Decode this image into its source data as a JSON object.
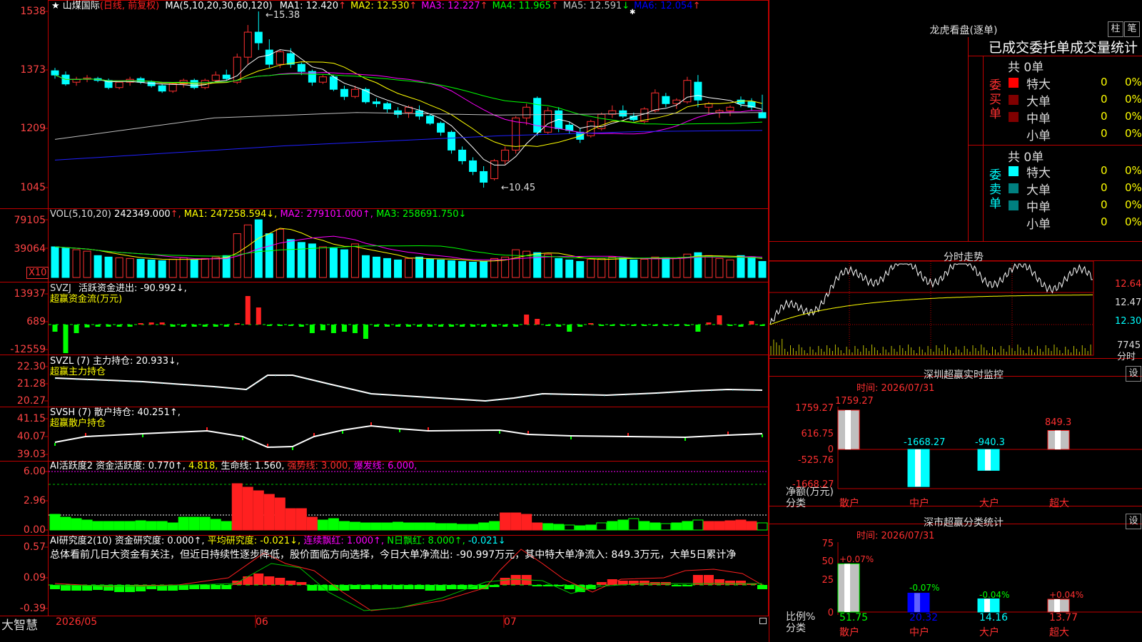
{
  "main": {
    "title": "山煤国际",
    "mode": "(日线, 前复权)",
    "ma_label": "MA(5,10,20,30,60,120)",
    "ma": [
      {
        "label": "MA1:",
        "value": "12.420",
        "arrow": "↑",
        "color": "#ffffff"
      },
      {
        "label": "MA2:",
        "value": "12.530",
        "arrow": "↑",
        "color": "#ffff00"
      },
      {
        "label": "MA3:",
        "value": "12.227",
        "arrow": "↑",
        "color": "#ff00ff"
      },
      {
        "label": "MA4:",
        "value": "11.965",
        "arrow": "↑",
        "color": "#00ff00"
      },
      {
        "label": "MA5:",
        "value": "12.591",
        "arrow": "↓",
        "color": "#c0c0c0"
      },
      {
        "label": "MA6:",
        "value": "12.054",
        "arrow": "↑",
        "color": "#0000ff"
      }
    ],
    "yticks": [
      "1538",
      "1373",
      "1209",
      "1045"
    ],
    "high_label": "15.38",
    "low_label": "10.45"
  },
  "vol": {
    "label": "VOL(5,10,20)",
    "value": "242349.000",
    "ma1": "MA1: 247258.594↓,",
    "ma2": "MA2: 279101.000↑,",
    "ma3": "MA3: 258691.750↓",
    "yticks": [
      "79105",
      "39064"
    ],
    "unit": "X10"
  },
  "svzj": {
    "label": "SVZJ",
    "line": "活跃资金进出: -90.992↓,",
    "sub": "超赢资金流(万元)",
    "yticks": [
      "13937",
      "689",
      "-12559"
    ]
  },
  "svzl": {
    "label": "SVZL (7) 主力持仓: 20.933↓,",
    "sub": "超赢主力持仓",
    "yticks": [
      "22.30",
      "21.28",
      "20.27"
    ]
  },
  "svsh": {
    "label": "SVSH (7) 散户持仓: 40.251↑,",
    "sub": "超赢散户持仓",
    "yticks": [
      "41.15",
      "40.07",
      "39.03"
    ]
  },
  "ai1": {
    "label": "AI活跃度2 资金活跃度: 0.770↑,",
    "v2": "4.818,",
    "v3": "生命线: 1.560,",
    "v4": "强势线: 3.000,",
    "v5": "爆发线: 6.000,",
    "yticks": [
      "6.00",
      "2.96",
      "0.00"
    ]
  },
  "ai2": {
    "label": "AI研究度2(10) 资金研究度: 0.000↑,",
    "v2": "平均研究度: -0.021↓,",
    "v3": "连续飘红: 1.000↑,",
    "v4": "N日飘红: 8.000↑,",
    "v5": "-0.021↓",
    "text": "总体看前几日大资金有关注，但近日持续性逐步降低，股价面临方向选择，今日大单净流出: -90.997万元，其中特大单净流入: 849.3万元，大单5日累计净",
    "yticks": [
      "0.57",
      "0.09",
      "-0.39"
    ]
  },
  "footer": {
    "brand": "大智慧",
    "months": [
      "2026/05",
      "06",
      "07"
    ]
  },
  "lhb": {
    "title": "龙虎看盘(逐单)",
    "btn1": "柱",
    "btn2": "笔",
    "tabs": "已成交委托单成交量统计",
    "buy": {
      "label": "委买单",
      "total": "共 0单",
      "rows": [
        {
          "name": "特大",
          "n": "0",
          "p": "0%",
          "color": "#ff0000"
        },
        {
          "name": "大单",
          "n": "0",
          "p": "0%",
          "color": "#800000"
        },
        {
          "name": "中单",
          "n": "0",
          "p": "0%",
          "color": "#800000"
        },
        {
          "name": "小单",
          "n": "0",
          "p": "0%",
          "color": "#000000"
        }
      ]
    },
    "sell": {
      "label": "委卖单",
      "total": "共 0单",
      "rows": [
        {
          "name": "特大",
          "n": "0",
          "p": "0%",
          "color": "#00ffff"
        },
        {
          "name": "大单",
          "n": "0",
          "p": "0%",
          "color": "#008080"
        },
        {
          "name": "中单",
          "n": "0",
          "p": "0%",
          "color": "#008080"
        },
        {
          "name": "小单",
          "n": "0",
          "p": "0%",
          "color": "#000000"
        }
      ]
    }
  },
  "intraday": {
    "title": "分时走势",
    "yticks": [
      "12.64",
      "12.47",
      "12.30"
    ],
    "vol_tick": "7745",
    "vol_label": "分时"
  },
  "monitor": {
    "title": "深圳超赢实时监控",
    "btn": "设",
    "time": "时间: 2026/07/31",
    "yticks": [
      "1759.27",
      "616.75",
      "0",
      "-525.76",
      "-1668.27"
    ],
    "ylabel": "净额(万元)",
    "xlabel": "分类",
    "categories": [
      "散户",
      "中户",
      "大户",
      "超大"
    ],
    "value_labels": [
      "1759.27",
      "-1668.27",
      "-940.3",
      "849.3"
    ]
  },
  "stats": {
    "title": "深市超赢分类统计",
    "btn": "设",
    "time": "时间: 2026/07/31",
    "yticks": [
      "75",
      "50",
      "25",
      "0"
    ],
    "ylabel": "比例%",
    "xlabel": "分类",
    "categories": [
      "散户",
      "中户",
      "大户",
      "超大"
    ],
    "changes": [
      "+0.07%",
      "-0.07%",
      "-0.04%",
      "+0.04%"
    ],
    "values_label": [
      "51.75",
      "20.32",
      "14.16",
      "13.77"
    ]
  },
  "chart_data": [
    {
      "type": "candlestick",
      "title": "山煤国际 (日线, 前复权)",
      "ylim": [
        10.45,
        15.38
      ],
      "y_ticks": [
        15.38,
        13.73,
        12.09,
        10.45
      ],
      "ohlc": [
        [
          13.72,
          13.8,
          13.5,
          13.6
        ],
        [
          13.6,
          13.7,
          13.3,
          13.35
        ],
        [
          13.4,
          13.55,
          13.3,
          13.48
        ],
        [
          13.48,
          13.6,
          13.4,
          13.52
        ],
        [
          13.5,
          13.55,
          13.4,
          13.45
        ],
        [
          13.45,
          13.5,
          13.2,
          13.25
        ],
        [
          13.25,
          13.45,
          13.2,
          13.4
        ],
        [
          13.4,
          13.55,
          13.3,
          13.48
        ],
        [
          13.5,
          13.55,
          13.35,
          13.4
        ],
        [
          13.4,
          13.45,
          13.25,
          13.3
        ],
        [
          13.3,
          13.35,
          13.1,
          13.15
        ],
        [
          13.15,
          13.4,
          13.1,
          13.35
        ],
        [
          13.35,
          13.5,
          13.25,
          13.45
        ],
        [
          13.45,
          13.5,
          13.2,
          13.25
        ],
        [
          13.25,
          13.5,
          13.2,
          13.45
        ],
        [
          13.45,
          13.7,
          13.4,
          13.6
        ],
        [
          13.6,
          13.75,
          13.45,
          13.5
        ],
        [
          13.4,
          14.2,
          13.35,
          14.1
        ],
        [
          14.1,
          15.0,
          13.9,
          14.8
        ],
        [
          14.8,
          15.38,
          14.3,
          14.5
        ],
        [
          14.3,
          14.6,
          13.8,
          13.9
        ],
        [
          13.9,
          14.3,
          13.8,
          14.25
        ],
        [
          14.2,
          14.35,
          13.8,
          13.9
        ],
        [
          13.9,
          13.95,
          13.6,
          13.7
        ],
        [
          13.7,
          13.75,
          13.3,
          13.4
        ],
        [
          13.4,
          13.6,
          13.35,
          13.55
        ],
        [
          13.55,
          13.6,
          13.15,
          13.2
        ],
        [
          13.2,
          13.3,
          12.9,
          13.0
        ],
        [
          13.0,
          13.3,
          12.95,
          13.2
        ],
        [
          13.2,
          13.25,
          12.8,
          12.85
        ],
        [
          12.85,
          12.95,
          12.7,
          12.8
        ],
        [
          12.8,
          12.85,
          12.55,
          12.65
        ],
        [
          12.6,
          12.7,
          12.4,
          12.5
        ],
        [
          12.55,
          12.75,
          12.4,
          12.7
        ],
        [
          12.6,
          12.75,
          12.35,
          12.45
        ],
        [
          12.45,
          12.5,
          12.2,
          12.25
        ],
        [
          12.25,
          12.3,
          11.9,
          12.0
        ],
        [
          12.0,
          12.05,
          11.4,
          11.5
        ],
        [
          11.5,
          11.6,
          11.1,
          11.2
        ],
        [
          11.2,
          11.3,
          10.8,
          10.9
        ],
        [
          10.9,
          11.05,
          10.45,
          10.6
        ],
        [
          10.7,
          11.25,
          10.65,
          11.2
        ],
        [
          11.2,
          11.6,
          11.1,
          11.5
        ],
        [
          11.5,
          12.45,
          11.4,
          12.4
        ],
        [
          12.4,
          12.8,
          12.2,
          12.7
        ],
        [
          12.95,
          13.0,
          11.9,
          12.0
        ],
        [
          12.0,
          12.7,
          11.95,
          12.6
        ],
        [
          12.6,
          12.7,
          12.0,
          12.1
        ],
        [
          12.2,
          12.3,
          11.95,
          12.05
        ],
        [
          12.0,
          12.1,
          11.7,
          11.8
        ],
        [
          11.9,
          12.35,
          11.85,
          12.3
        ],
        [
          12.1,
          12.55,
          12.05,
          12.5
        ],
        [
          12.5,
          12.75,
          12.4,
          12.6
        ],
        [
          12.6,
          12.75,
          12.4,
          12.45
        ],
        [
          12.45,
          12.55,
          12.3,
          12.35
        ],
        [
          12.3,
          12.7,
          12.25,
          12.65
        ],
        [
          12.6,
          13.2,
          12.55,
          13.1
        ],
        [
          13.0,
          13.1,
          12.7,
          12.8
        ],
        [
          12.8,
          12.95,
          12.65,
          12.9
        ],
        [
          12.85,
          13.55,
          12.8,
          13.45
        ],
        [
          13.4,
          13.6,
          12.7,
          12.9
        ],
        [
          12.7,
          12.85,
          12.5,
          12.8
        ],
        [
          12.55,
          12.65,
          12.4,
          12.6
        ],
        [
          12.6,
          12.75,
          12.45,
          12.7
        ],
        [
          12.9,
          13.0,
          12.7,
          12.8
        ],
        [
          12.85,
          12.95,
          12.6,
          12.7
        ],
        [
          12.55,
          13.05,
          12.5,
          12.4
        ]
      ]
    }
  ]
}
